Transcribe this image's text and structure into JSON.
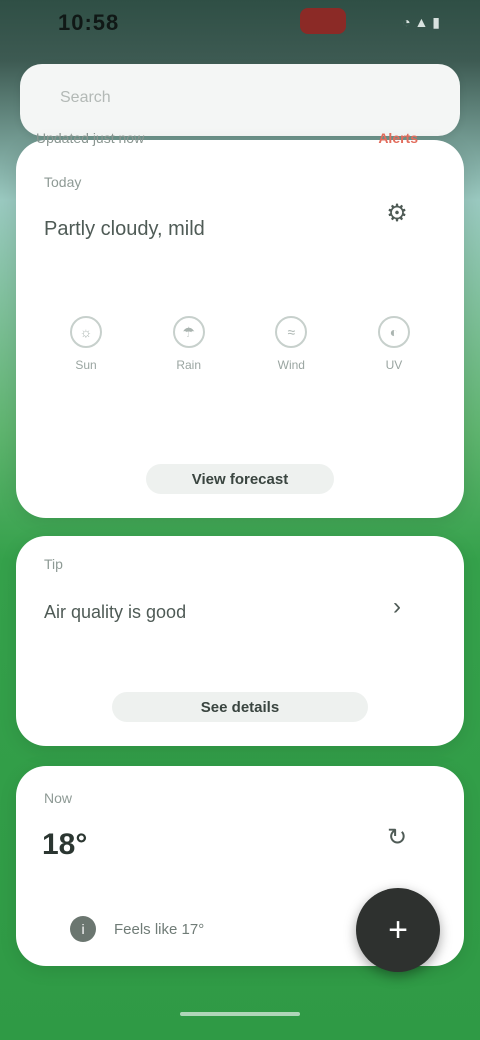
{
  "status_bar": {
    "time": "10:58",
    "icons": "◔ ▲ ▮"
  },
  "search": {
    "placeholder": "Search"
  },
  "strip": {
    "left_text": "Updated just now",
    "right_text": "Alerts"
  },
  "card1": {
    "caption": "Today",
    "title": "Partly cloudy, mild",
    "action_icon": "gear-icon",
    "features": [
      {
        "icon": "☼",
        "label": "Sun"
      },
      {
        "icon": "☂",
        "label": "Rain"
      },
      {
        "icon": "≈",
        "label": "Wind"
      },
      {
        "icon": "◐",
        "label": "UV"
      }
    ],
    "button_label": "View forecast"
  },
  "card2": {
    "caption": "Tip",
    "title": "Air quality is good",
    "action_icon": "chevron-right-icon",
    "button_label": "See details"
  },
  "card3": {
    "caption": "Now",
    "big_value": "18°",
    "action_icon": "refresh-icon",
    "info_text": "Feels like 17°"
  },
  "fab": {
    "icon": "plus-icon",
    "glyph": "+"
  },
  "colors": {
    "accent_green": "#35a14b",
    "alert_red": "#e26c5c",
    "fab": "#2e312f"
  }
}
